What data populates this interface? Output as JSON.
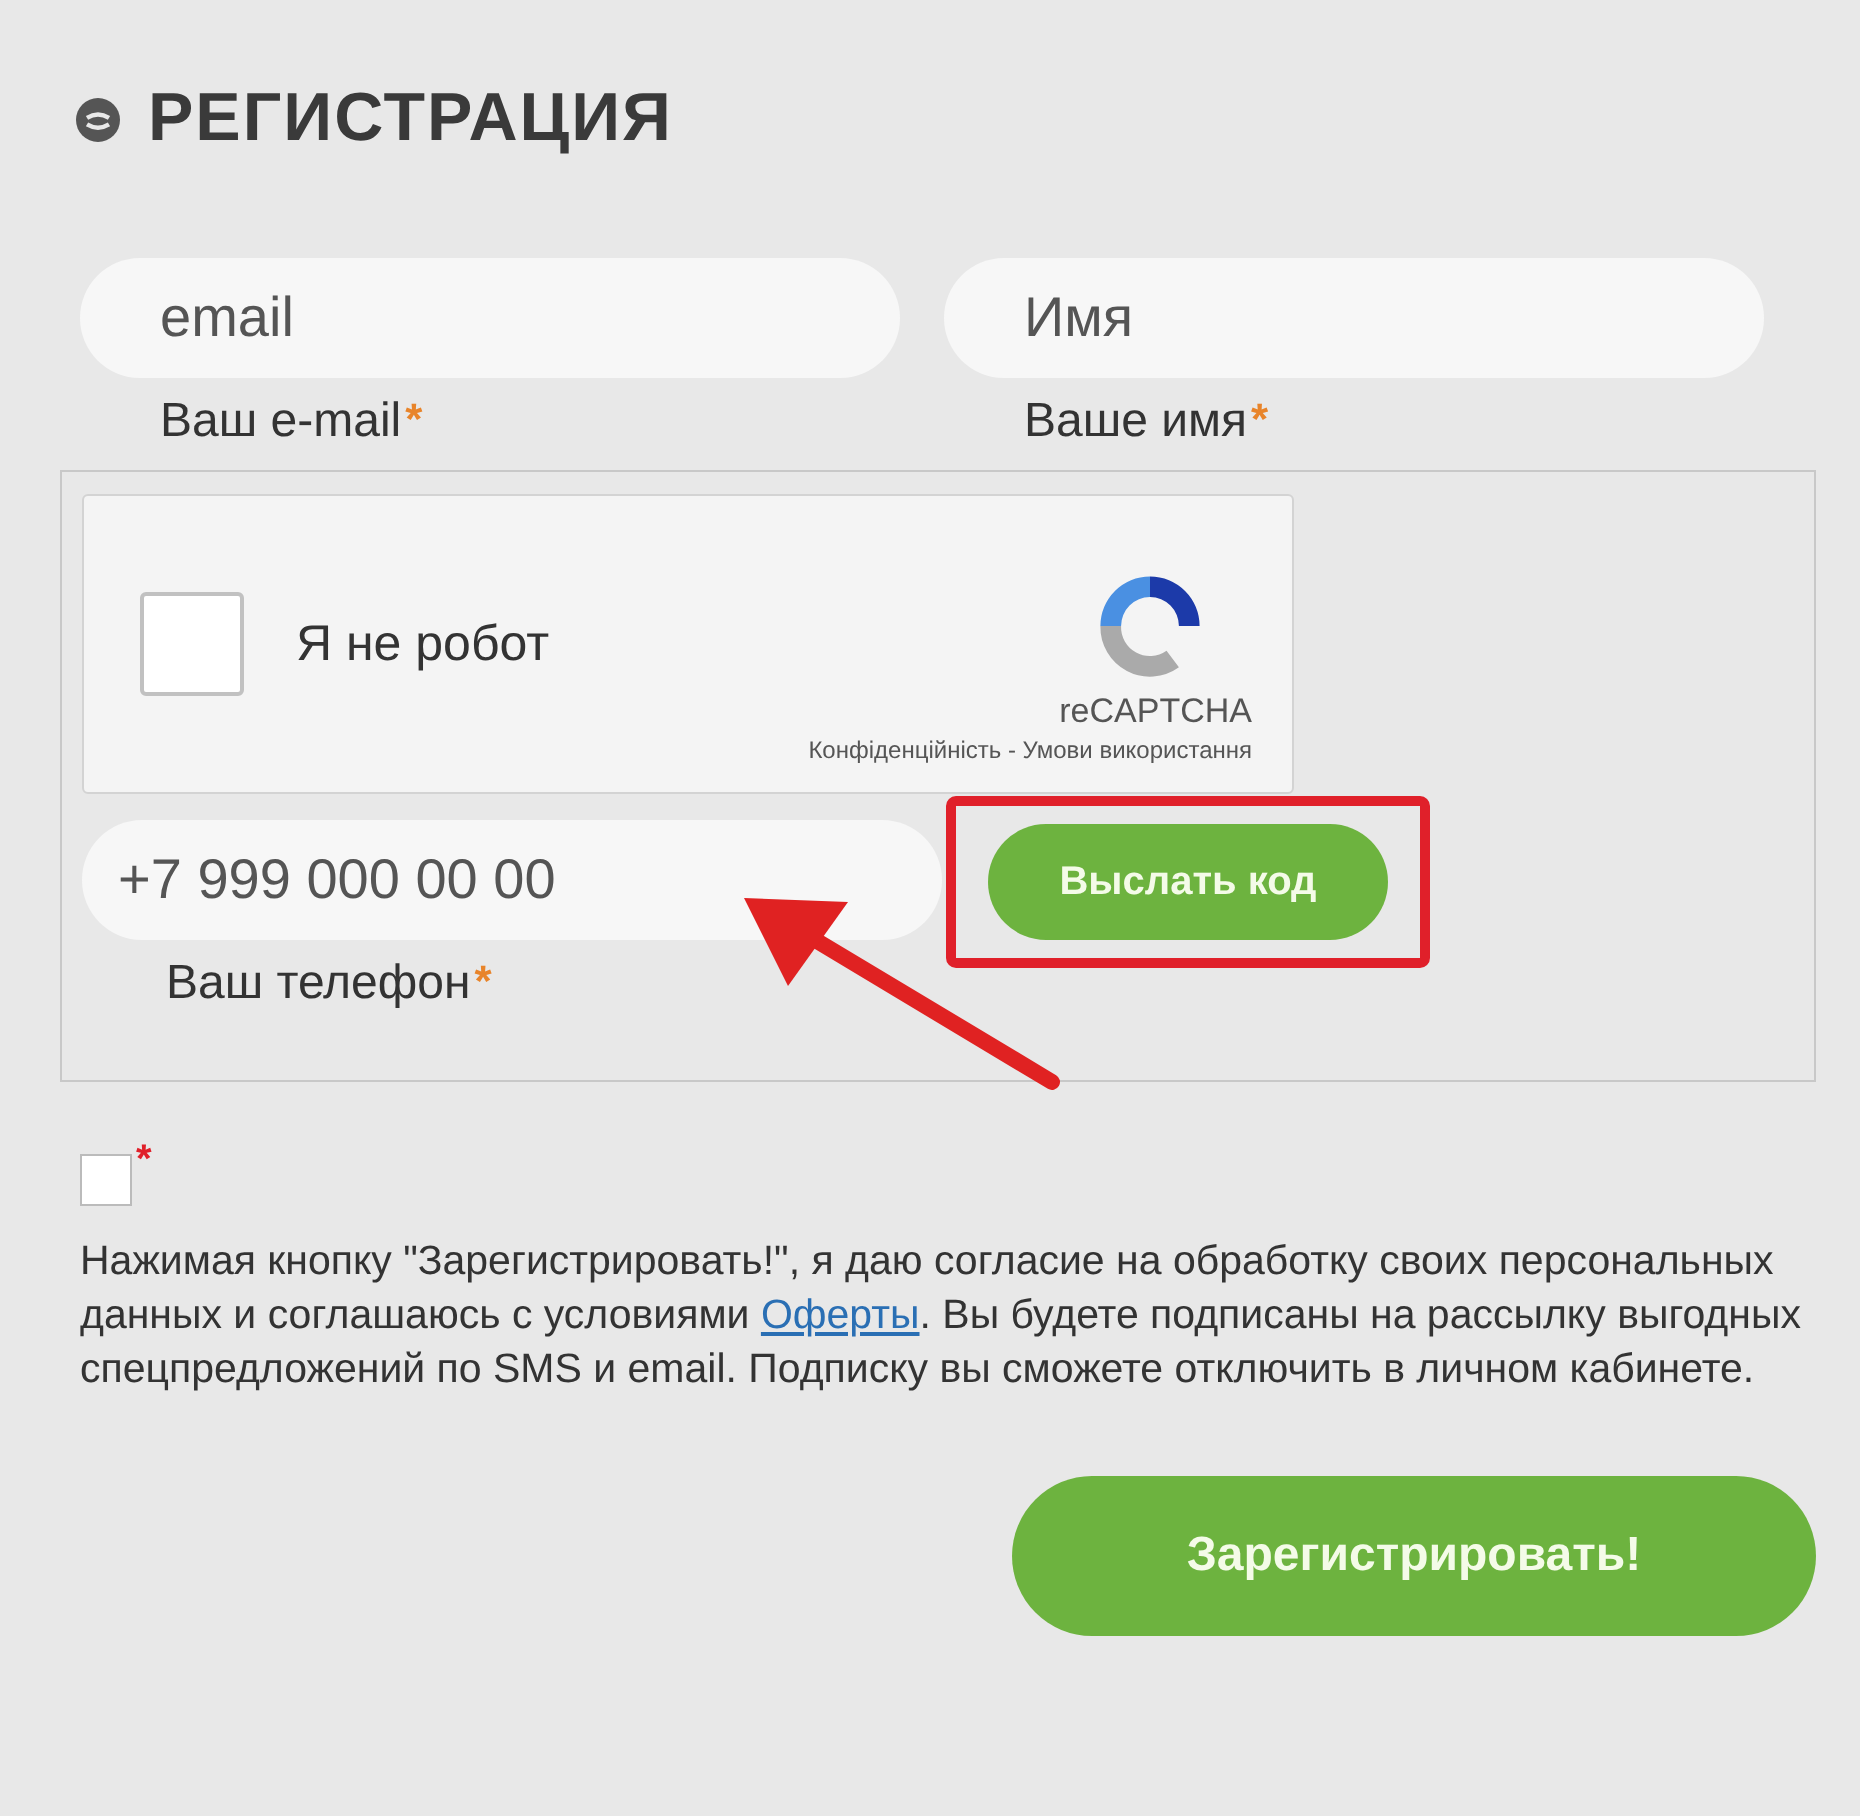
{
  "title": "РЕГИСТРАЦИЯ",
  "fields": [
    {
      "placeholder": "email",
      "label": "Ваш e-mail",
      "required_mark": "*"
    },
    {
      "placeholder": "Имя",
      "label": "Ваше имя",
      "required_mark": "*"
    }
  ],
  "captcha": {
    "checked": false,
    "label": "Я не робот",
    "brand": "reCAPTCHA",
    "footer": "Конфіденційність - Умови використання"
  },
  "phone": {
    "placeholder": "+7 999 000 00 00",
    "label": "Ваш телефон",
    "required_mark": "*",
    "button": "Выслать код",
    "highlighted": true
  },
  "consent": {
    "checked": false,
    "required_mark": "*",
    "before": "Нажимая кнопку \"Зарегистрировать!\", я даю согласие на обработку своих персональных данных и соглашаюсь с условиями ",
    "link": "Оферты",
    "after": ". Вы будете подписаны на рассылку выгодных спецпредложений по SMS и email. Подписку вы сможете отключить в личном кабинете."
  },
  "submit": "Зарегистрировать!"
}
